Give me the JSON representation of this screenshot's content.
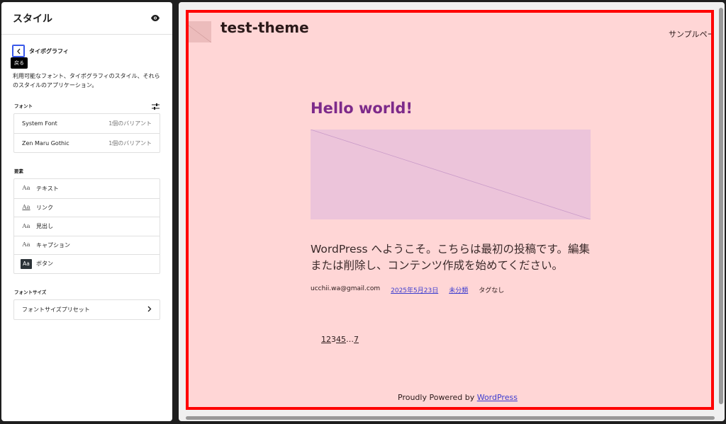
{
  "sidebar": {
    "title": "スタイル",
    "nav_title": "タイポグラフィ",
    "tooltip": "戻る",
    "description": "利用可能なフォント、タイポグラフィのスタイル、それらのスタイルのアプリケーション。",
    "fonts_label": "フォント",
    "fonts": [
      {
        "name": "System Font",
        "variants": "1個のバリアント"
      },
      {
        "name": "Zen Maru Gothic",
        "variants": "1個のバリアント"
      }
    ],
    "elements_label": "要素",
    "elements": [
      {
        "icon_text": "Aa",
        "label": "テキスト"
      },
      {
        "icon_text": "Aa",
        "label": "リンク"
      },
      {
        "icon_text": "Aa",
        "label": "見出し"
      },
      {
        "icon_text": "Aa",
        "label": "キャプション"
      },
      {
        "icon_text": "Aa",
        "label": "ボタン"
      }
    ],
    "font_sizes_label": "フォントサイズ",
    "font_size_presets": "フォントサイズプリセット"
  },
  "canvas": {
    "site_title": "test-theme",
    "nav_link": "サンプルページ",
    "post_title": "Hello world!",
    "content_line1": "WordPress へようこそ。こちらは最初の投稿です。編集",
    "content_line2": "または削除し、コンテンツ作成を始めてください。",
    "meta": {
      "author": "ucchii.wa@gmail.com",
      "date": "2025年5月23日",
      "category": "未分類",
      "tags": "タグなし"
    },
    "pager": [
      "1",
      "2",
      "3",
      "4",
      "5",
      "…",
      "7"
    ],
    "footer_prefix": "Proudly Powered by ",
    "footer_link": "WordPress"
  },
  "colors": {
    "canvas_bg": "#ffd6d6",
    "highlight_border": "#ff0000",
    "post_title": "#7d2a8a",
    "link": "#3c3ccf"
  }
}
